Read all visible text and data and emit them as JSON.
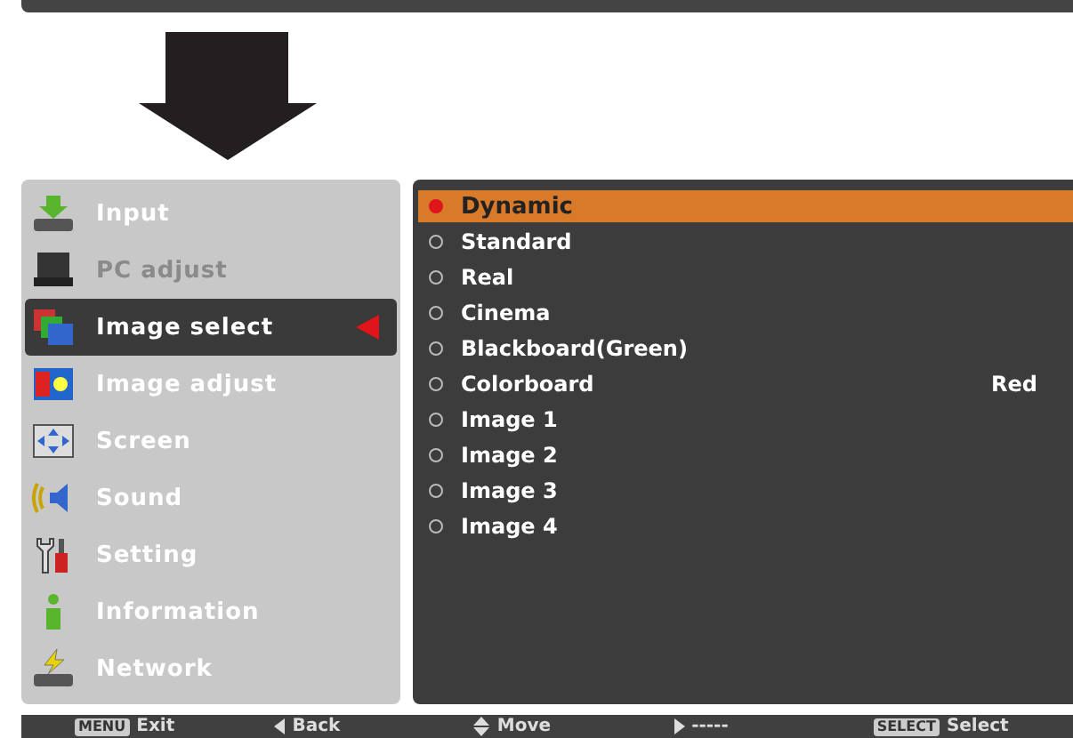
{
  "menu": [
    {
      "label": "Input",
      "kind": "input",
      "selected": false,
      "disabled": false
    },
    {
      "label": "PC adjust",
      "kind": "pc",
      "selected": false,
      "disabled": true
    },
    {
      "label": "Image select",
      "kind": "image-select",
      "selected": true,
      "disabled": false
    },
    {
      "label": "Image adjust",
      "kind": "image-adjust",
      "selected": false,
      "disabled": false
    },
    {
      "label": "Screen",
      "kind": "screen",
      "selected": false,
      "disabled": false
    },
    {
      "label": "Sound",
      "kind": "sound",
      "selected": false,
      "disabled": false
    },
    {
      "label": "Setting",
      "kind": "setting",
      "selected": false,
      "disabled": false
    },
    {
      "label": "Information",
      "kind": "info",
      "selected": false,
      "disabled": false
    },
    {
      "label": "Network",
      "kind": "network",
      "selected": false,
      "disabled": false
    }
  ],
  "options": [
    {
      "label": "Dynamic",
      "selected": true
    },
    {
      "label": "Standard",
      "selected": false
    },
    {
      "label": "Real",
      "selected": false
    },
    {
      "label": "Cinema",
      "selected": false
    },
    {
      "label": "Blackboard(Green)",
      "selected": false
    },
    {
      "label": "Colorboard",
      "selected": false,
      "value": "Red"
    },
    {
      "label": "Image 1",
      "selected": false
    },
    {
      "label": "Image 2",
      "selected": false
    },
    {
      "label": "Image 3",
      "selected": false
    },
    {
      "label": "Image 4",
      "selected": false
    }
  ],
  "footer": [
    {
      "kind": "key",
      "key": "MENU",
      "label": "Exit"
    },
    {
      "kind": "left",
      "label": "Back"
    },
    {
      "kind": "updown",
      "label": "Move"
    },
    {
      "kind": "right",
      "label": "-----"
    },
    {
      "kind": "key",
      "key": "SELECT",
      "label": "Select"
    }
  ]
}
